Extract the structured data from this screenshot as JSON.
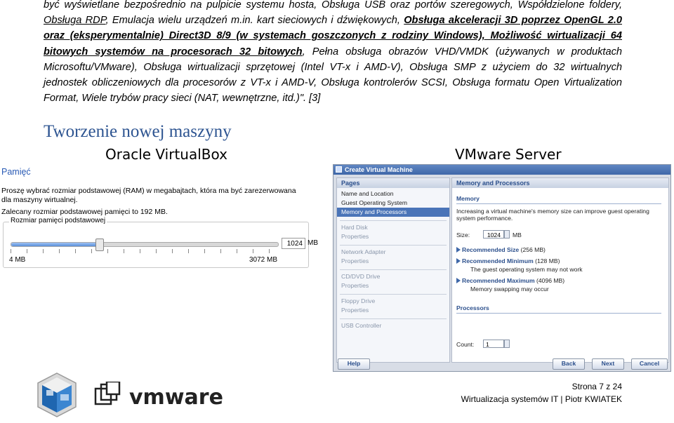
{
  "paragraph": {
    "seg1": "być wyświetlane bezpośrednio na pulpicie systemu hosta, Obsługa USB oraz portów szeregowych, Współdzielone foldery, ",
    "seg2": "Obsługa RDP",
    "seg3": ", Emulacja wielu urządzeń m.in. kart sieciowych i dźwiękowych, ",
    "seg4": "Obsługa akceleracji 3D poprzez OpenGL 2.0 oraz (eksperymentalnie) Direct3D 8/9 (w systemach goszczonych z rodziny Windows), Możliwość wirtualizacji 64 bitowych systemów na procesorach 32 bitowych",
    "seg5": ", Pełna obsługa obrazów VHD/VMDK (używanych w produktach Microsoftu/VMware), Obsługa wirtualizacji sprzętowej (Intel VT-x i AMD-V), Obsługa SMP z użyciem do 32 wirtualnych jednostek obliczeniowych dla procesorów z VT-x i AMD-V, Obsługa kontrolerów SCSI, Obsługa formatu Open Virtualization Format, Wiele trybów pracy sieci (NAT, wewnętrzne, itd.)\". [3]"
  },
  "heading": "Tworzenie nowej maszyny",
  "col_left_title": "Oracle VirtualBox",
  "col_right_title": "VMware Server",
  "virtualbox": {
    "title": "Pamięć",
    "text": "Proszę wybrać rozmiar podstawowej (RAM) w megabajtach, która ma być zarezerwowana dla maszyny wirtualnej.",
    "suggested": "Zalecany rozmiar podstawowej pamięci to 192 MB.",
    "box_label": "Rozmiar pamięci podstawowej",
    "value": "1024",
    "value_unit": "MB",
    "min_label": "4 MB",
    "max_label": "3072 MB",
    "slider_fraction": 0.33
  },
  "vmware": {
    "window_title": "Create Virtual Machine",
    "pages_header": "Pages",
    "pages": [
      {
        "label": "Name and Location",
        "state": "normal"
      },
      {
        "label": "Guest Operating System",
        "state": "normal"
      },
      {
        "label": "Memory and Processors",
        "state": "selected"
      }
    ],
    "pages2": [
      {
        "label": "Hard Disk",
        "sub": "Properties"
      },
      {
        "label": "Network Adapter",
        "sub": "Properties"
      },
      {
        "label": "CD/DVD Drive",
        "sub": "Properties"
      },
      {
        "label": "Floppy Drive",
        "sub": "Properties"
      },
      {
        "label": "USB Controller",
        "sub": ""
      }
    ],
    "right_header": "Memory and Processors",
    "memory_section": "Memory",
    "memory_text": "Increasing a virtual machine's memory size can improve guest operating system performance.",
    "size_label": "Size:",
    "size_value": "1024",
    "size_unit": "MB",
    "rec_size": "Recommended Size",
    "rec_size_val": "(256 MB)",
    "rec_min": "Recommended Minimum",
    "rec_min_val": "(128 MB)",
    "rec_min_text": "The guest operating system may not work",
    "rec_max": "Recommended Maximum",
    "rec_max_val": "(4096 MB)",
    "rec_max_text": "Memory swapping may occur",
    "processors_section": "Processors",
    "count_label": "Count:",
    "count_value": "1",
    "help": "Help",
    "back": "Back",
    "next": "Next",
    "cancel": "Cancel"
  },
  "footer": {
    "page": "Strona 7 z 24",
    "line2": "Wirtualizacja systemów IT | Piotr KWIATEK"
  },
  "vmware_logo_text": "vmware"
}
